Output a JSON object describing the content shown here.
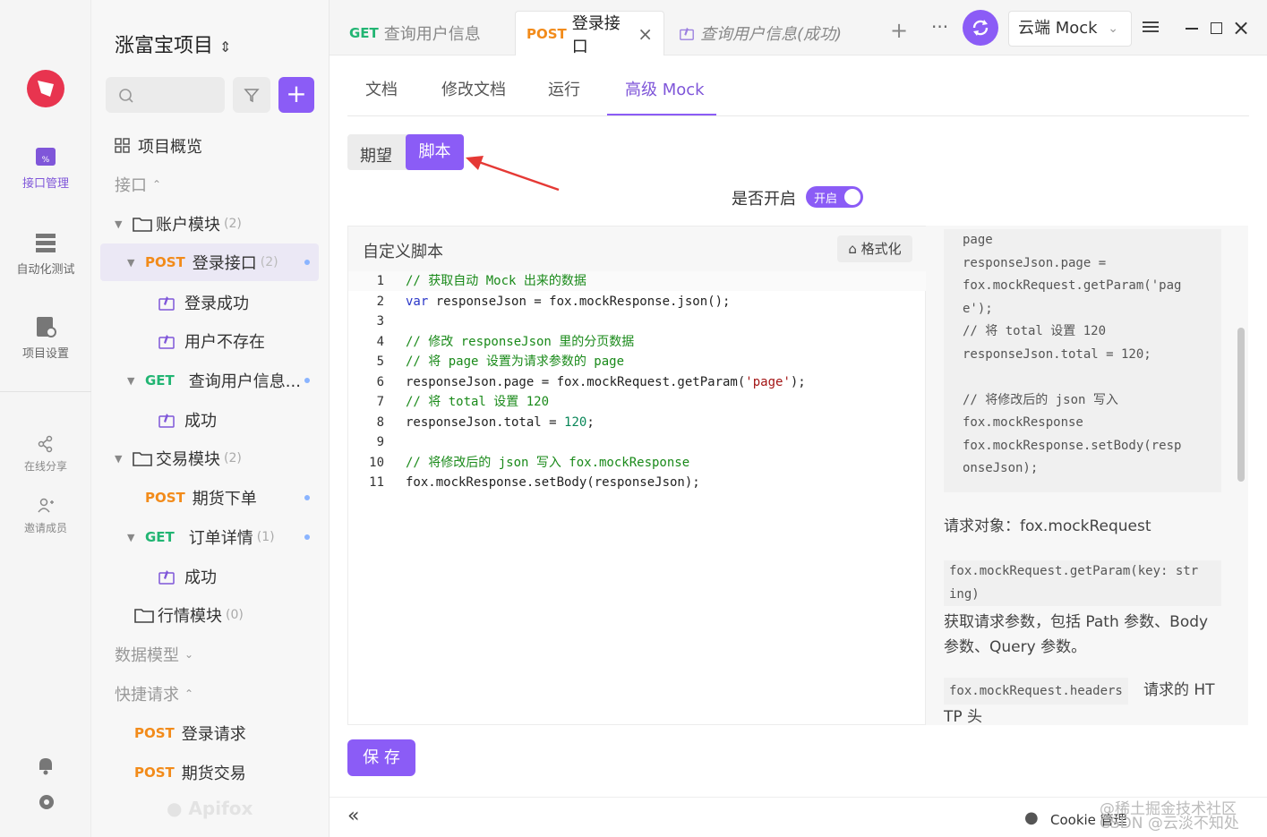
{
  "rail": {
    "items": [
      {
        "label": "接口管理",
        "icon": "api-management-icon"
      },
      {
        "label": "自动化测试",
        "icon": "automation-icon"
      },
      {
        "label": "项目设置",
        "icon": "project-settings-icon"
      },
      {
        "label": "在线分享",
        "icon": "share-icon"
      },
      {
        "label": "邀请成员",
        "icon": "invite-member-icon"
      }
    ]
  },
  "sidebar": {
    "project_title": "涨富宝项目",
    "overview": "项目概览",
    "section_api": "接口",
    "section_models": "数据模型",
    "section_quick": "快捷请求",
    "brand": "Apifox",
    "tree": [
      {
        "kind": "folder",
        "label": "账户模块",
        "count": "(2)"
      },
      {
        "kind": "api",
        "method": "POST",
        "label": "登录接口",
        "count": "(2)"
      },
      {
        "kind": "case",
        "label": "登录成功"
      },
      {
        "kind": "case",
        "label": "用户不存在"
      },
      {
        "kind": "api",
        "method": "GET",
        "label": "查询用户信息..."
      },
      {
        "kind": "case",
        "label": "成功"
      },
      {
        "kind": "folder",
        "label": "交易模块",
        "count": "(2)"
      },
      {
        "kind": "api",
        "method": "POST",
        "label": "期货下单"
      },
      {
        "kind": "api",
        "method": "GET",
        "label": "订单详情",
        "count": "(1)"
      },
      {
        "kind": "case",
        "label": "成功"
      },
      {
        "kind": "folder",
        "label": "行情模块",
        "count": "(0)"
      }
    ],
    "quick": [
      {
        "method": "POST",
        "label": "登录请求"
      },
      {
        "method": "POST",
        "label": "期货交易"
      }
    ]
  },
  "tabs": [
    {
      "method": "GET",
      "label": "查询用户信息"
    },
    {
      "method": "POST",
      "label": "登录接口"
    },
    {
      "label": "查询用户信息(成功)"
    }
  ],
  "header": {
    "env_label": "云端 Mock"
  },
  "subtabs": [
    "文档",
    "修改文档",
    "运行",
    "高级 Mock"
  ],
  "mock": {
    "mode_expect": "期望",
    "mode_script": "脚本",
    "enable_label": "是否开启",
    "enable_value": "开启",
    "editor_title": "自定义脚本",
    "format_label": "格式化",
    "save_label": "保 存"
  },
  "code_lines": [
    "// 获取自动 Mock 出来的数据",
    "var responseJson = fox.mockResponse.json();",
    "",
    "// 修改 responseJson 里的分页数据",
    "// 将 page 设置为请求参数的 page",
    "responseJson.page = fox.mockRequest.getParam('page');",
    "// 将 total 设置 120",
    "responseJson.total = 120;",
    "",
    "// 将修改后的 json 写入 fox.mockResponse",
    "fox.mockResponse.setBody(responseJson);"
  ],
  "doc": {
    "snippet": "page\nresponseJson.page =\nfox.mockRequest.getParam('pag\ne');\n// 将 total 设置 120\nresponseJson.total = 120;\n\n// 将修改后的 json 写入\nfox.mockResponse\nfox.mockResponse.setBody(resp\nonseJson);",
    "request_obj": "请求对象：fox.mockRequest",
    "getparam_code": "fox.mockRequest.getParam(key: str\ning)",
    "getparam_desc1": "获取请求参数，包括 Path 参数、Body",
    "getparam_desc2": "参数、Query 参数。",
    "headers_code": "fox.mockRequest.headers",
    "headers_desc": "请求的 HT",
    "headers_desc2": "TP 头"
  },
  "footer": {
    "cookie": "Cookie 管理",
    "watermark1": "@稀土掘金技术社区",
    "watermark2": "CSDN @云淡不知处"
  },
  "colors": {
    "accent": "#8b5cf6",
    "post": "#f28b1a",
    "get": "#22b573"
  }
}
